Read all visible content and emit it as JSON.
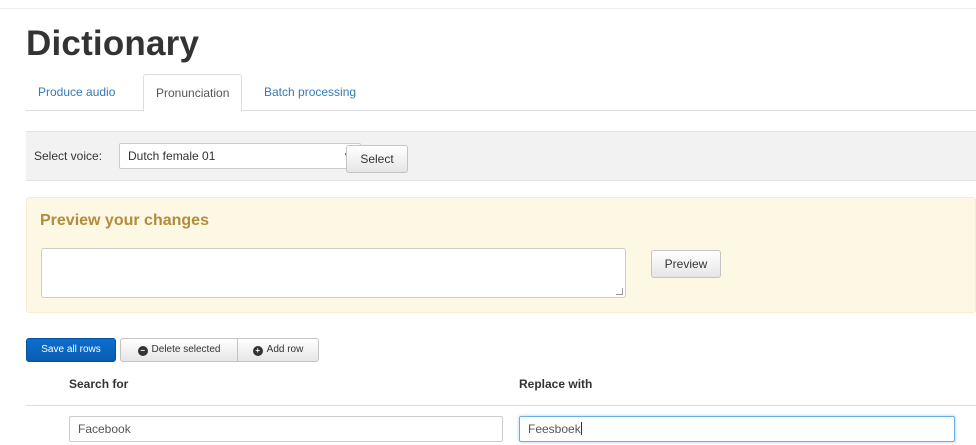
{
  "page": {
    "title": "Dictionary"
  },
  "tabs": [
    {
      "label": "Produce audio",
      "active": false
    },
    {
      "label": "Pronunciation",
      "active": true
    },
    {
      "label": "Batch processing",
      "active": false
    }
  ],
  "voice": {
    "label": "Select voice:",
    "selected": "Dutch female 01",
    "select_button": "Select"
  },
  "preview": {
    "title": "Preview your changes",
    "text_value": "",
    "preview_button": "Preview"
  },
  "toolbar": {
    "save_all": "Save all rows",
    "delete_selected": "Delete selected",
    "add_row": "Add row"
  },
  "table": {
    "columns": [
      "Search for",
      "Replace with"
    ],
    "rows": [
      {
        "search": "Facebook",
        "replace": "Feesboek"
      }
    ]
  },
  "colors": {
    "accent": "#337ab7",
    "primary_button": "#0a64c0",
    "warning_bg": "#fcf8e3",
    "warning_title": "#b28b3c"
  }
}
